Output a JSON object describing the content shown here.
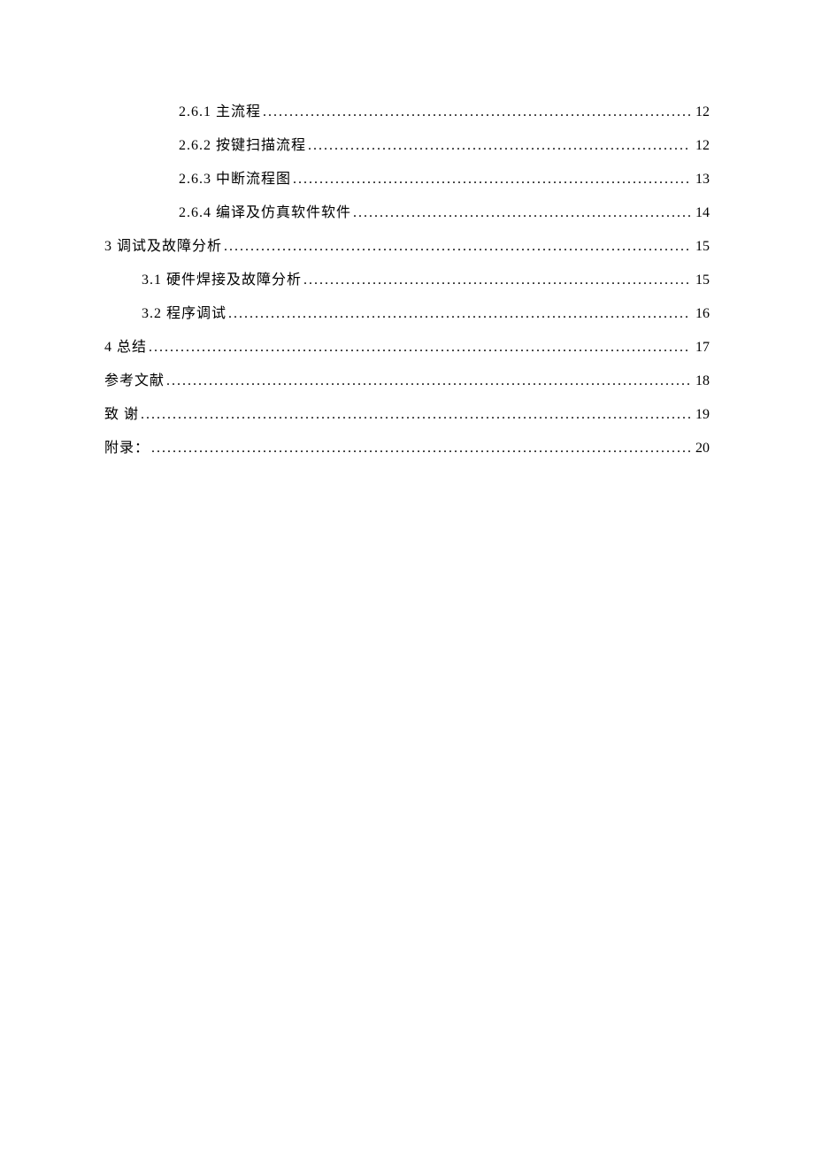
{
  "toc": {
    "entries": [
      {
        "label": "2.6.1 主流程",
        "page": "12",
        "indent": 3
      },
      {
        "label": "2.6.2 按键扫描流程",
        "page": "12",
        "indent": 3
      },
      {
        "label": "2.6.3 中断流程图",
        "page": "13",
        "indent": 3
      },
      {
        "label": "2.6.4 编译及仿真软件软件",
        "page": "14",
        "indent": 3
      },
      {
        "label": "3 调试及故障分析",
        "page": "15",
        "indent": 1
      },
      {
        "label": "3.1 硬件焊接及故障分析",
        "page": "15",
        "indent": 2
      },
      {
        "label": "3.2 程序调试",
        "page": "16",
        "indent": 2
      },
      {
        "label": "4 总结",
        "page": "17",
        "indent": 1
      },
      {
        "label": "参考文献",
        "page": "18",
        "indent": 1
      },
      {
        "label": "致 谢",
        "page": "19",
        "indent": 1
      },
      {
        "label": "附录：",
        "page": "20",
        "indent": 1
      }
    ]
  }
}
